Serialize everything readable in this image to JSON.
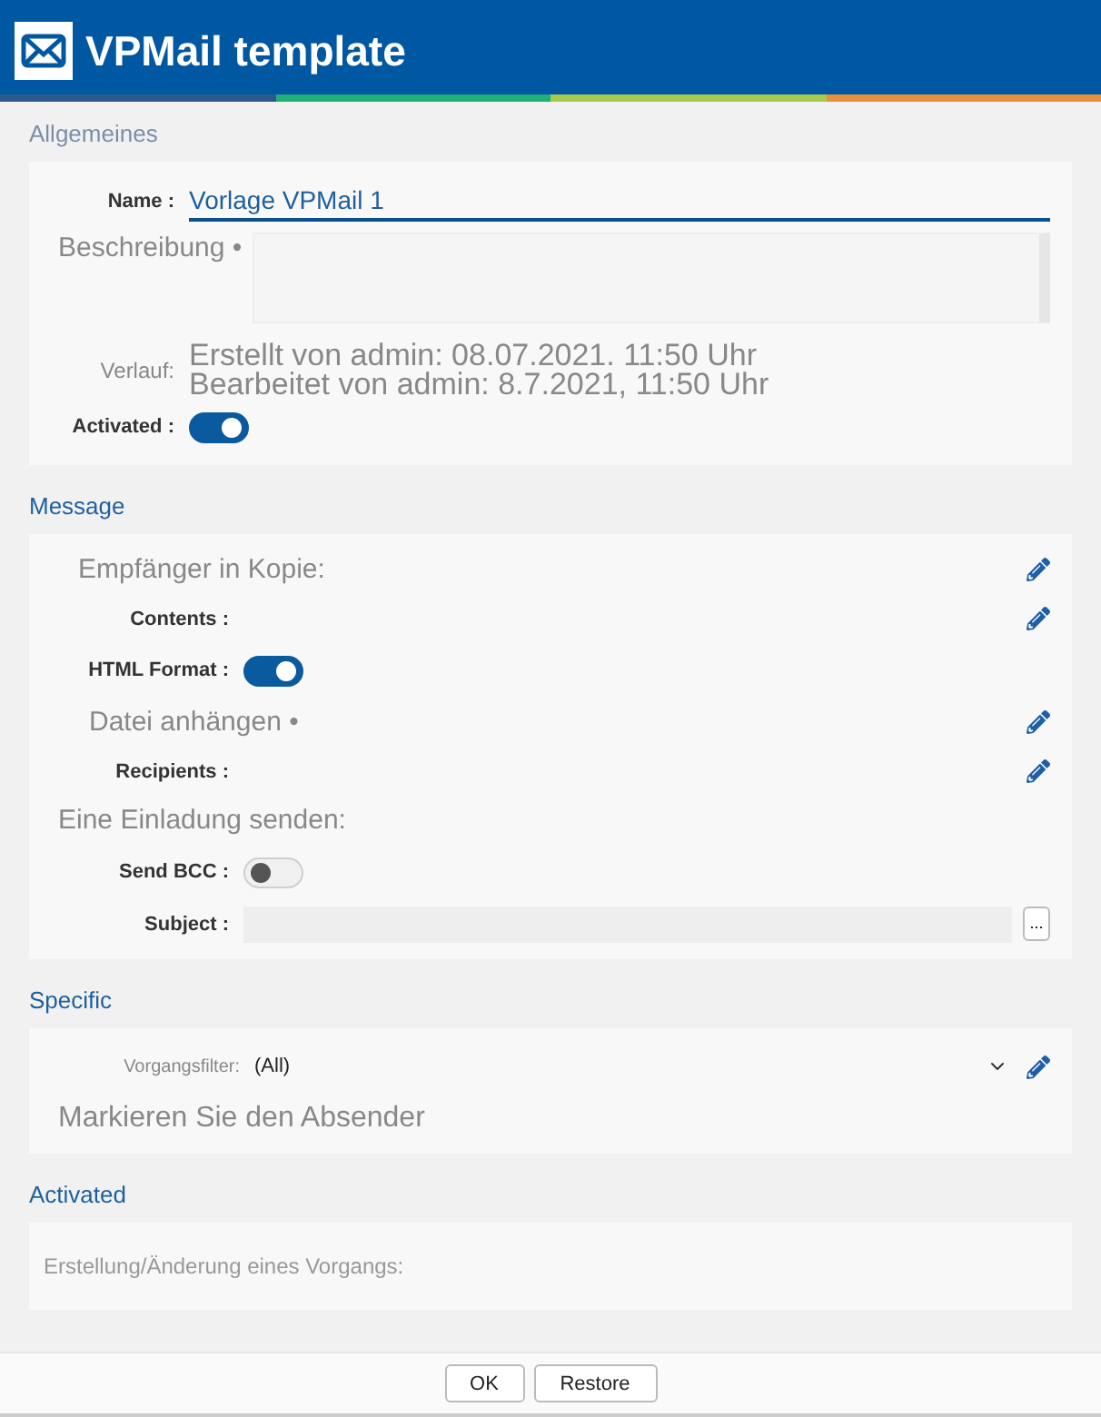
{
  "window": {
    "title": "VPMail template"
  },
  "sections": [
    {
      "title": "Allgemeines",
      "muted": true,
      "rows": [
        {
          "kind": "input",
          "label": "Name :",
          "value": "Vorlage VPMail 1"
        },
        {
          "kind": "textarea",
          "label": "Beschreibung •"
        },
        {
          "kind": "history",
          "label": "Verlauf:",
          "lines": [
            "Erstellt von admin: 08.07.2021. 11:50 Uhr",
            "Bearbeitet von admin: 8.7.2021, 11:50 Uhr"
          ]
        },
        {
          "kind": "toggle",
          "label": "Activated :",
          "on": true
        }
      ]
    },
    {
      "title": "Message",
      "muted": false,
      "rows": [
        {
          "kind": "heading",
          "label": "Empfänger in Kopie:",
          "editable": true
        },
        {
          "kind": "edit",
          "label": "Contents :"
        },
        {
          "kind": "toggle",
          "label": "HTML Format :",
          "on": true
        },
        {
          "kind": "heading",
          "label": "Datei anhängen •",
          "editable": true
        },
        {
          "kind": "edit",
          "label": "Recipients :"
        },
        {
          "kind": "heading",
          "label": "Eine Einladung senden:",
          "editable": false
        },
        {
          "kind": "toggle",
          "label": "Send BCC :",
          "on": false
        },
        {
          "kind": "lookup",
          "label": "Subject :",
          "button": "..."
        }
      ]
    },
    {
      "title": "Specific",
      "muted": false,
      "rows": [
        {
          "kind": "select",
          "label": "Vorgangsfilter:",
          "value": "(All)"
        },
        {
          "kind": "heading",
          "label": "Markieren Sie den Absender",
          "editable": false
        }
      ]
    },
    {
      "title": "Activated",
      "muted": false,
      "rows": [
        {
          "kind": "note",
          "label": "Erstellung/Änderung eines Vorgangs:"
        }
      ]
    }
  ],
  "buttons": [
    "OK",
    "Restore"
  ]
}
